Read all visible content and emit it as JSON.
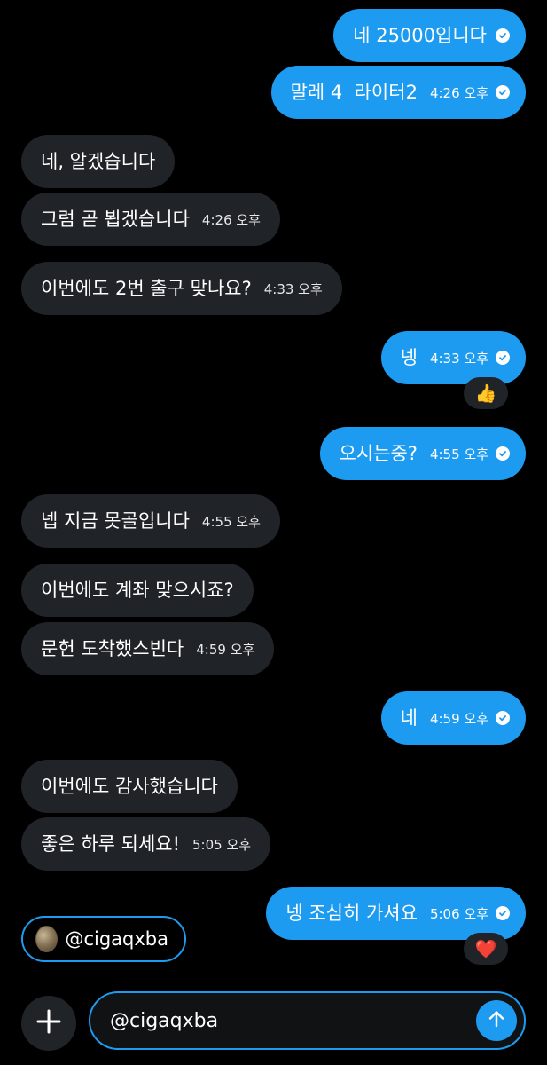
{
  "colors": {
    "outgoing_bubble": "#1D9BF0",
    "incoming_bubble": "#202327",
    "background": "#000000",
    "accent": "#1D9BF0"
  },
  "messages": [
    {
      "text": "네 25000입니다",
      "time": "",
      "sent": true
    },
    {
      "text": "말레 4  라이터2",
      "time": "4:26 오후",
      "sent": true
    },
    {
      "text": "네, 알겠습니다",
      "time": ""
    },
    {
      "text": "그럼 곧 뵙겠습니다",
      "time": "4:26 오후"
    },
    {
      "text": "이번에도 2번 출구 맞나요?",
      "time": "4:33 오후"
    },
    {
      "text": "넹",
      "time": "4:33 오후",
      "sent": true
    },
    {
      "text": "오시는중?",
      "time": "4:55 오후",
      "sent": true
    },
    {
      "text": "넵 지금 못골입니다",
      "time": "4:55 오후"
    },
    {
      "text": "이번에도 계좌 맞으시죠?",
      "time": ""
    },
    {
      "text": "문헌 도착했스빈다",
      "time": "4:59 오후"
    },
    {
      "text": "네",
      "time": "4:59 오후",
      "sent": true
    },
    {
      "text": "이번에도 감사했습니다",
      "time": ""
    },
    {
      "text": "좋은 하루 되세요!",
      "time": "5:05 오후"
    },
    {
      "text": "넹 조심히 가셔요",
      "time": "5:06 오후",
      "sent": true
    }
  ],
  "reactions": [
    {
      "emoji": "👍",
      "icon": "thumbs-up-icon"
    },
    {
      "emoji": "❤️",
      "icon": "heart-icon"
    }
  ],
  "mention_chip": {
    "label": "@cigaqxba"
  },
  "composer": {
    "value": "@cigaqxba"
  },
  "icons": {
    "add": "plus-icon",
    "send": "arrow-up-icon",
    "read": "check-circle-icon"
  }
}
